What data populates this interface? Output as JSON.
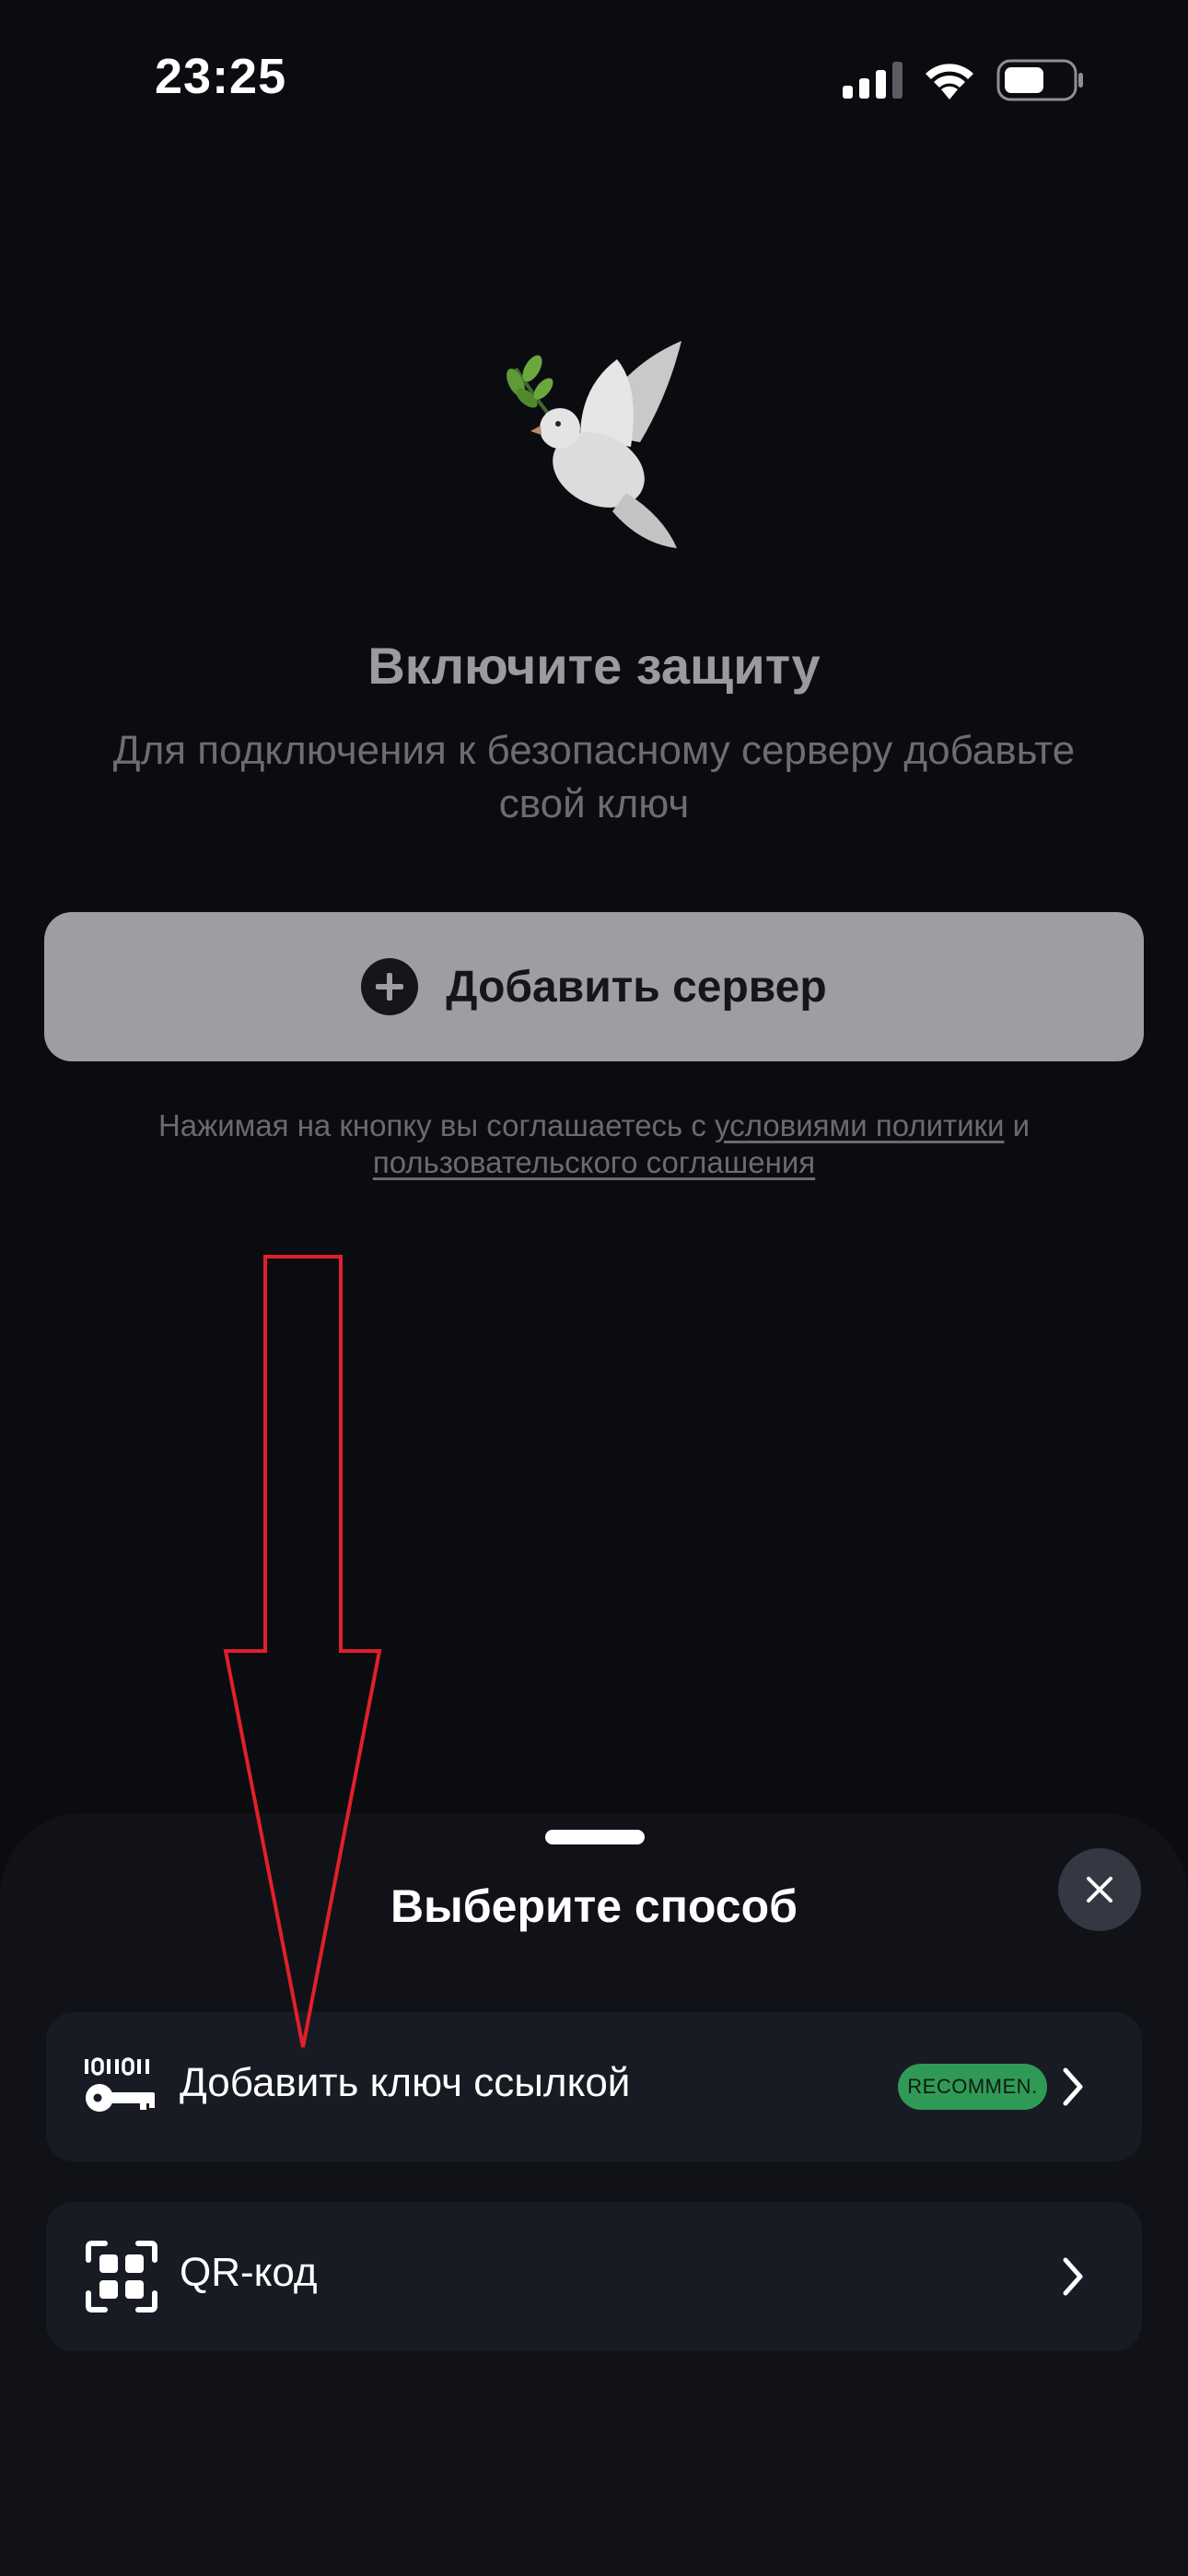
{
  "status_bar": {
    "time": "23:25",
    "icons": [
      "signal-icon",
      "wifi-icon",
      "battery-icon"
    ]
  },
  "onboarding": {
    "icon": "dove-icon",
    "title": "Включите защиту",
    "subtitle": "Для подключения к безопасному серверу добавьте свой ключ",
    "add_server_button": "Добавить сервер",
    "consent_prefix": "Нажимая на кнопку вы соглашаетесь с",
    "consent_link_policy": "условиями политики",
    "consent_and": "и",
    "consent_link_agreement": "пользовательского соглашения"
  },
  "sheet": {
    "title": "Выберите способ",
    "options": [
      {
        "icon": "binary-key-icon",
        "label": "Добавить ключ ссылкой",
        "badge": "RECOMMEN."
      },
      {
        "icon": "qr-code-icon",
        "label": "QR-код",
        "badge": ""
      }
    ]
  },
  "colors": {
    "background": "#0b0c10",
    "sheet": "#101217",
    "option_row": "#181b23",
    "badge_green": "#2f9a56",
    "annotation_arrow": "#e0202a"
  }
}
